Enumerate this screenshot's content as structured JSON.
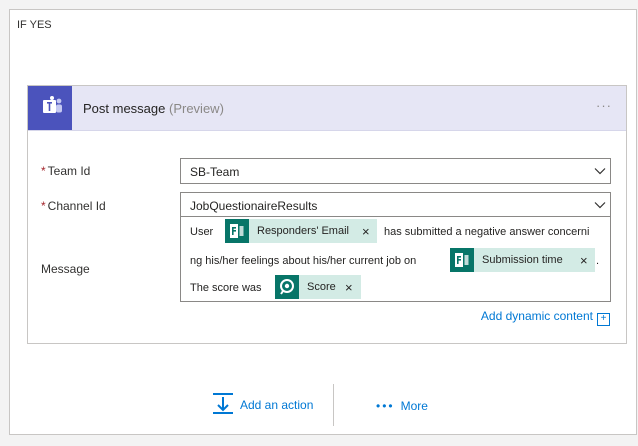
{
  "branch": {
    "title": "IF YES"
  },
  "card": {
    "title": "Post message",
    "title_suffix": "(Preview)",
    "menu": "···"
  },
  "fields": {
    "team": {
      "label": "Team Id",
      "required": "*",
      "value": "SB-Team"
    },
    "channel": {
      "label": "Channel Id",
      "required": "*",
      "value": "JobQuestionaireResults"
    },
    "message": {
      "label": "Message",
      "text_1": "User",
      "token_1": "Responders' Email",
      "text_2": "has submitted a negative answer concerni",
      "text_3": "ng his/her feelings about his/her current job on",
      "token_2": "Submission time",
      "text_4": ".",
      "text_5": "The score was",
      "token_3": "Score",
      "remove": "×"
    }
  },
  "add_dynamic": {
    "label": "Add dynamic content",
    "icon": "+"
  },
  "footer": {
    "add_action": "Add an action",
    "more": "More",
    "more_dots": "•••"
  },
  "colors": {
    "teams": "#4b53bc",
    "token_bg": "#d3ebe5",
    "token_icon": "#077568",
    "link": "#0078d4",
    "header_bg": "#e6e6f5"
  },
  "icons": {
    "teams": "teams-icon",
    "forms": "forms-icon",
    "score": "score-icon",
    "add_action": "add-action-icon"
  }
}
